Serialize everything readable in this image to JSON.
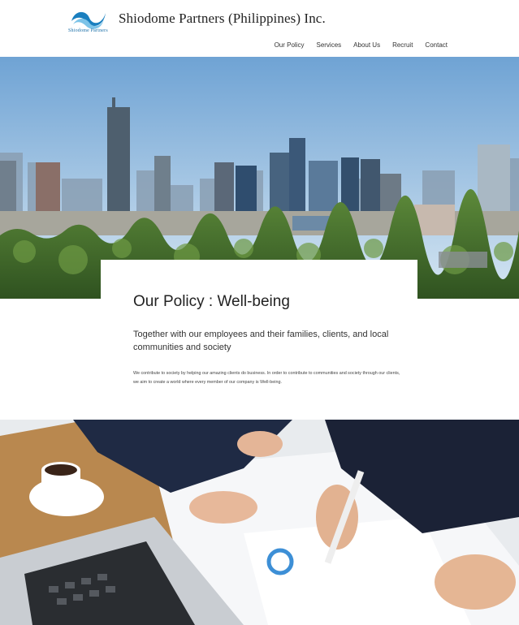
{
  "header": {
    "logo_text": "Shiodome Partners",
    "company_name": "Shiodome Partners (Philippines) Inc.",
    "nav": [
      {
        "label": "Our Policy"
      },
      {
        "label": "Services"
      },
      {
        "label": "About Us"
      },
      {
        "label": "Recruit"
      },
      {
        "label": "Contact"
      }
    ]
  },
  "policy": {
    "title": "Our Policy : Well-being",
    "subtitle": "Together with our employees and their families, clients, and local communities and society",
    "body": "We contribute to society by helping our amazing clients do business. In order to contribute to communities and society through our clients, we aim to create a world where every member of our company is Well-being."
  },
  "colors": {
    "brand_blue": "#1a7fbf",
    "sky": "#9ec3e0",
    "trees": "#3f6b2a"
  }
}
